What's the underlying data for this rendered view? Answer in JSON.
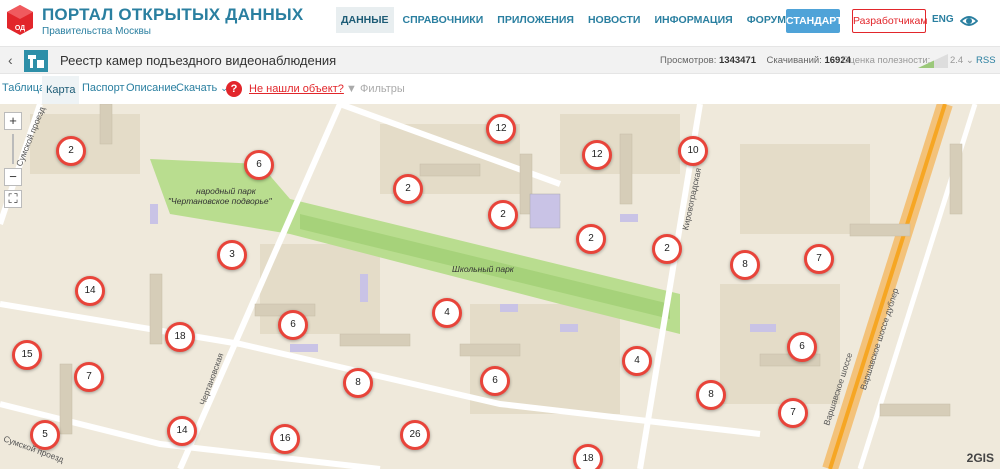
{
  "header": {
    "portal_title": "ПОРТАЛ ОТКРЫТЫХ ДАННЫХ",
    "portal_subtitle": "Правительства Москвы",
    "nav": [
      "ДАННЫЕ",
      "СПРАВОЧНИКИ",
      "ПРИЛОЖЕНИЯ",
      "НОВОСТИ",
      "ИНФОРМАЦИЯ",
      "ФОРУМ"
    ],
    "active_nav": "ДАННЫЕ",
    "standards_label": "СТАНДАРТЫ",
    "developers_label": "Разработчикам",
    "lang_label": "ENG",
    "accent": "#2a7fa0",
    "brand_red": "#e2262b"
  },
  "dataset": {
    "back_icon": "chevron-left-icon",
    "title": "Реестр камер подъездного видеонаблюдения",
    "views_label": "Просмотров:",
    "views": "1343471",
    "downloads_label": "Скачиваний:",
    "downloads": "16924",
    "rating_label": "Оценка полезности:",
    "rating": "2.4",
    "rss_label": "RSS"
  },
  "tabs": {
    "table": "Таблица",
    "map": "Карта",
    "passport": "Паспорт",
    "description": "Описание",
    "download": "Скачать",
    "help": "?",
    "not_found": "Не нашли объект?",
    "filters": "Фильтры",
    "active": "Карта"
  },
  "map": {
    "zoom_in": "+",
    "zoom_out": "−",
    "attribution": "2GIS",
    "streets": {
      "sumskoy_proezd": "Сумской проезд",
      "sumskoy_proezd_bottom": "Сумской проезд",
      "chertanovskaya": "Чертановская",
      "kirovogradskaya": "Кировоградская",
      "varshavskoe": "Варшавское шоссе",
      "varshavskoe_dubler": "Варшавское шоссе дублер",
      "park_name": "народный парк",
      "park_name2": "\"Чертановское подворье\"",
      "school_park": "Школьный парк"
    },
    "cluster_color": "#e8443a",
    "clusters": [
      "2",
      "6",
      "12",
      "12",
      "10",
      "2",
      "2",
      "2",
      "2",
      "3",
      "8",
      "7",
      "14",
      "6",
      "4",
      "18",
      "6",
      "15",
      "7",
      "4",
      "8",
      "6",
      "8",
      "7",
      "5",
      "14",
      "16",
      "26",
      "18"
    ]
  }
}
